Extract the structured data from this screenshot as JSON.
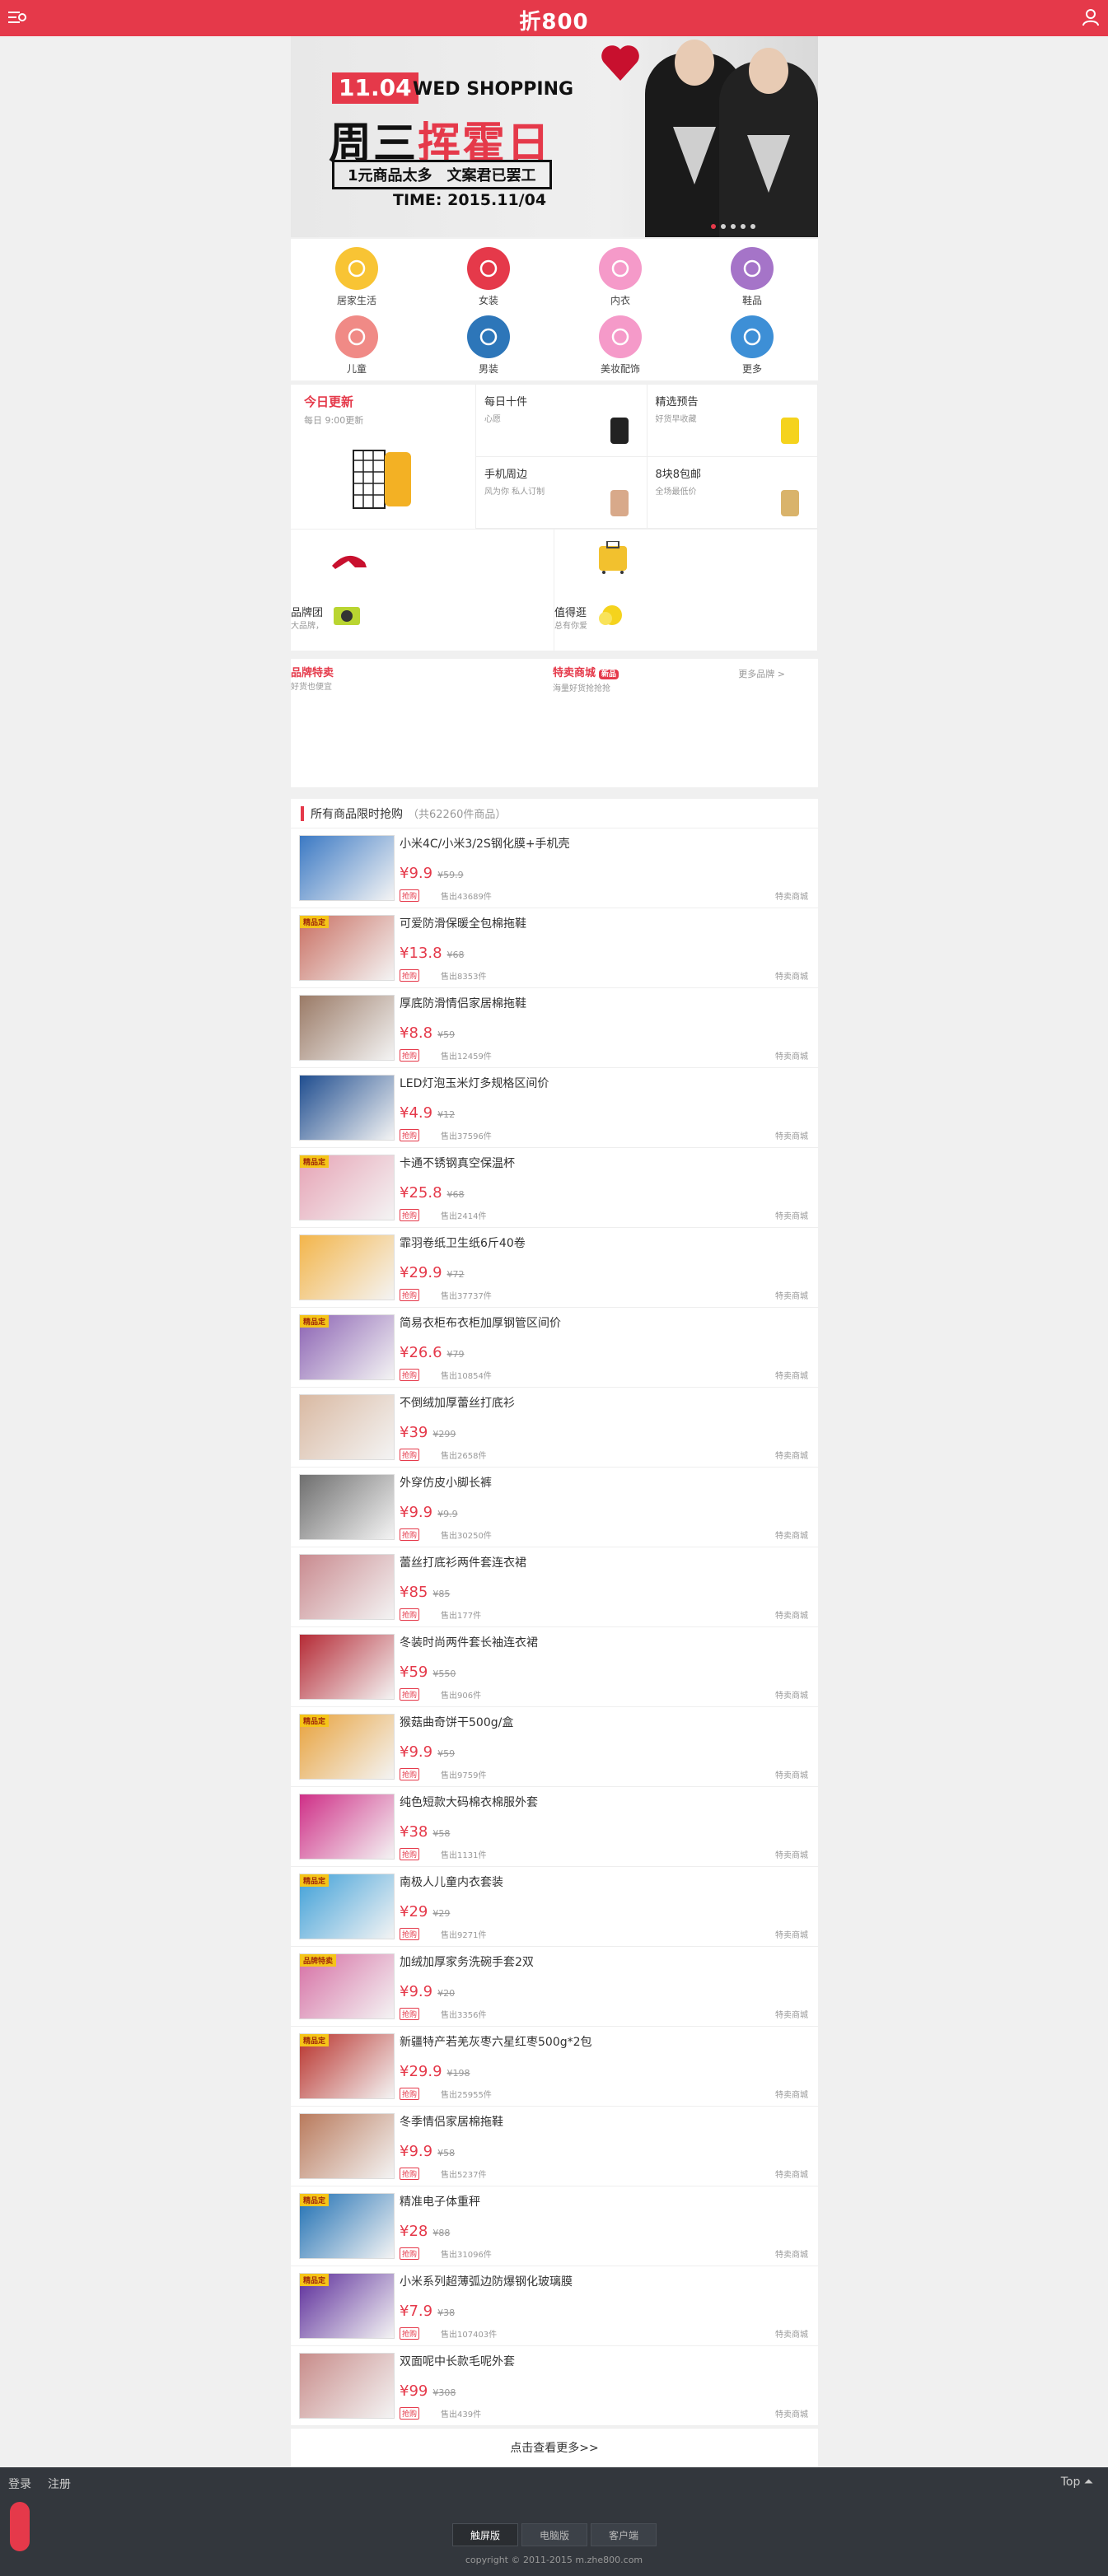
{
  "header": {
    "logo": "折800"
  },
  "banner": {
    "date": "11.04",
    "headline_en": "WED SHOPPING",
    "headline_cn_1": "周三",
    "headline_cn_2": "挥霍日",
    "sub": "1元商品太多　文案君已罢工",
    "time": "TIME: 2015.11/04"
  },
  "categories": [
    {
      "label": "居家生活",
      "color": "#f8c434",
      "icon": "bowl-icon"
    },
    {
      "label": "女装",
      "color": "#e5394a",
      "icon": "dress-icon"
    },
    {
      "label": "内衣",
      "color": "#f59ac9",
      "icon": "bra-icon"
    },
    {
      "label": "鞋品",
      "color": "#a574c8",
      "icon": "heel-icon"
    },
    {
      "label": "儿童",
      "color": "#f08a86",
      "icon": "horse-icon"
    },
    {
      "label": "男装",
      "color": "#2d76b9",
      "icon": "shirt-icon"
    },
    {
      "label": "美妆配饰",
      "color": "#f59ac9",
      "icon": "ring-icon"
    },
    {
      "label": "更多",
      "color": "#3d8fd6",
      "icon": "grid-icon"
    }
  ],
  "feature": {
    "today": {
      "title": "今日更新",
      "sub": "每日 9:00更新"
    },
    "cells": [
      {
        "title": "每日十件",
        "sub": "心愿"
      },
      {
        "title": "精选预告",
        "sub": "好货早收藏"
      },
      {
        "title": "手机周边",
        "sub": "风为你 私人订制"
      },
      {
        "title": "8块8包邮",
        "sub": "全场最低价"
      }
    ]
  },
  "brands": [
    {
      "title": "品牌团",
      "sub": "大品牌，"
    },
    {
      "title": "值得逛",
      "sub": "总有你爱"
    }
  ],
  "special": {
    "left_title": "品牌特卖",
    "left_sub": "好货也便宜",
    "mid_title": "特卖商城",
    "mid_tag": "新品",
    "mid_sub": "海量好货抢抢抢",
    "more": "更多品牌 >"
  },
  "list": {
    "title": "所有商品限时抢购",
    "count": "（共62260件商品）",
    "items": [
      {
        "title": "小米4C/小米3/2S钢化膜+手机壳",
        "price": "¥9.9",
        "orig": "¥59.9",
        "sold": "售出43689件",
        "shop": "特卖商城",
        "badge": "",
        "color": "#3b79c4"
      },
      {
        "title": "可爱防滑保暖全包棉拖鞋",
        "price": "¥13.8",
        "orig": "¥68",
        "sold": "售出8353件",
        "shop": "特卖商城",
        "badge": "精品定",
        "color": "#c96f62"
      },
      {
        "title": "厚底防滑情侣家居棉拖鞋",
        "price": "¥8.8",
        "orig": "¥59",
        "sold": "售出12459件",
        "shop": "特卖商城",
        "badge": "",
        "color": "#9a7a66"
      },
      {
        "title": "LED灯泡玉米灯多规格区间价",
        "price": "¥4.9",
        "orig": "¥12",
        "sold": "售出37596件",
        "shop": "特卖商城",
        "badge": "",
        "color": "#1f4d8f"
      },
      {
        "title": "卡通不锈钢真空保温杯",
        "price": "¥25.8",
        "orig": "¥68",
        "sold": "售出2414件",
        "shop": "特卖商城",
        "badge": "精品定",
        "color": "#e6a3b5"
      },
      {
        "title": "霏羽卷纸卫生纸6斤40卷",
        "price": "¥29.9",
        "orig": "¥72",
        "sold": "售出37737件",
        "shop": "特卖商城",
        "badge": "",
        "color": "#f3b54a"
      },
      {
        "title": "简易衣柜布衣柜加厚钢管区间价",
        "price": "¥26.6",
        "orig": "¥79",
        "sold": "售出10854件",
        "shop": "特卖商城",
        "badge": "精品定",
        "color": "#8b62b3"
      },
      {
        "title": "不倒绒加厚蕾丝打底衫",
        "price": "¥39",
        "orig": "¥299",
        "sold": "售出2658件",
        "shop": "特卖商城",
        "badge": "",
        "color": "#d9b9a2"
      },
      {
        "title": "外穿仿皮小脚长裤",
        "price": "¥9.9",
        "orig": "¥9.9",
        "sold": "售出30250件",
        "shop": "特卖商城",
        "badge": "",
        "color": "#6e6e6e"
      },
      {
        "title": "蕾丝打底衫两件套连衣裙",
        "price": "¥85",
        "orig": "¥85",
        "sold": "售出177件",
        "shop": "特卖商城",
        "badge": "",
        "color": "#c98a8f"
      },
      {
        "title": "冬装时尚两件套长袖连衣裙",
        "price": "¥59",
        "orig": "¥550",
        "sold": "售出906件",
        "shop": "特卖商城",
        "badge": "",
        "color": "#b52a35"
      },
      {
        "title": "猴菇曲奇饼干500g/盒",
        "price": "¥9.9",
        "orig": "¥59",
        "sold": "售出9759件",
        "shop": "特卖商城",
        "badge": "精品定",
        "color": "#e8a23c"
      },
      {
        "title": "纯色短款大码棉衣棉服外套",
        "price": "¥38",
        "orig": "¥58",
        "sold": "售出1131件",
        "shop": "特卖商城",
        "badge": "",
        "color": "#cf2f87"
      },
      {
        "title": "南极人儿童内衣套装",
        "price": "¥29",
        "orig": "¥29",
        "sold": "售出9271件",
        "shop": "特卖商城",
        "badge": "精品定",
        "color": "#3fa0d8"
      },
      {
        "title": "加绒加厚家务洗碗手套2双",
        "price": "¥9.9",
        "orig": "¥20",
        "sold": "售出3356件",
        "shop": "特卖商城",
        "badge": "品牌特卖",
        "color": "#d66fa4"
      },
      {
        "title": "新疆特产若羌灰枣六星红枣500g*2包",
        "price": "¥29.9",
        "orig": "¥198",
        "sold": "售出25955件",
        "shop": "特卖商城",
        "badge": "精品定",
        "color": "#b8312b"
      },
      {
        "title": "冬季情侣家居棉拖鞋",
        "price": "¥9.9",
        "orig": "¥58",
        "sold": "售出5237件",
        "shop": "特卖商城",
        "badge": "",
        "color": "#b97a5c"
      },
      {
        "title": "精准电子体重秤",
        "price": "¥28",
        "orig": "¥88",
        "sold": "售出31096件",
        "shop": "特卖商城",
        "badge": "精品定",
        "color": "#1e6fb3"
      },
      {
        "title": "小米系列超薄弧边防爆钢化玻璃膜",
        "price": "¥7.9",
        "orig": "¥38",
        "sold": "售出107403件",
        "shop": "特卖商城",
        "badge": "精品定",
        "color": "#5b2c9a"
      },
      {
        "title": "双面呢中长款毛呢外套",
        "price": "¥99",
        "orig": "¥308",
        "sold": "售出439件",
        "shop": "特卖商城",
        "badge": "",
        "color": "#c88c8a"
      }
    ],
    "flash_label": "抢购",
    "load_more": "点击查看更多>>"
  },
  "footer": {
    "login": "登录",
    "register": "注册",
    "top": "Top ⏶",
    "versions": [
      "触屏版",
      "电脑版",
      "客户端"
    ],
    "copyright": "copyright © 2011-2015 m.zhe800.com"
  }
}
